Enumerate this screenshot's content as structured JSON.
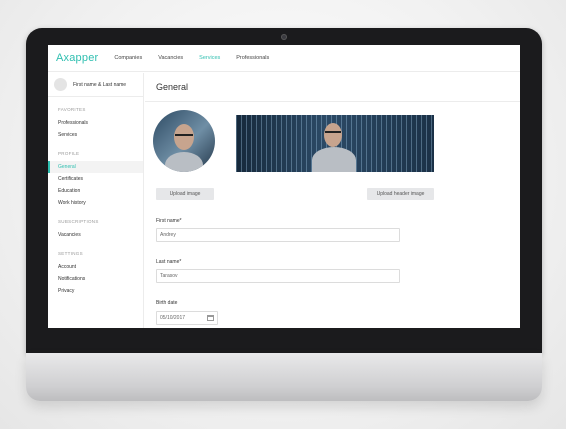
{
  "app": {
    "logo": "Axapper"
  },
  "topnav": {
    "items": [
      {
        "label": "Companies"
      },
      {
        "label": "Vacancies"
      },
      {
        "label": "Services",
        "active": true
      },
      {
        "label": "Professionals"
      }
    ]
  },
  "user": {
    "name": "First name & Last name"
  },
  "sidebar": {
    "sections": [
      {
        "label": "FAVORITES",
        "items": [
          {
            "label": "Professionals"
          },
          {
            "label": "Services"
          }
        ]
      },
      {
        "label": "PROFILE",
        "items": [
          {
            "label": "General",
            "active": true
          },
          {
            "label": "Certificates"
          },
          {
            "label": "Education"
          },
          {
            "label": "Work history"
          }
        ]
      },
      {
        "label": "SUBSCRIPTIONS",
        "items": [
          {
            "label": "Vacancies"
          }
        ]
      },
      {
        "label": "SETTINGS",
        "items": [
          {
            "label": "Account"
          },
          {
            "label": "Notifications"
          },
          {
            "label": "Privacy"
          }
        ]
      }
    ]
  },
  "main": {
    "title": "General",
    "upload_image_label": "Upload image",
    "upload_header_label": "Upload header image",
    "fields": {
      "first_name": {
        "label": "First name*",
        "value": "Andrey"
      },
      "last_name": {
        "label": "Last name*",
        "value": "Tarasov"
      },
      "birth_date": {
        "label": "Birth date",
        "value": "05/10/2017"
      }
    }
  },
  "colors": {
    "accent": "#2fbfb0",
    "bezel": "#1b1b1d"
  },
  "icons": {
    "calendar": "calendar-icon"
  }
}
